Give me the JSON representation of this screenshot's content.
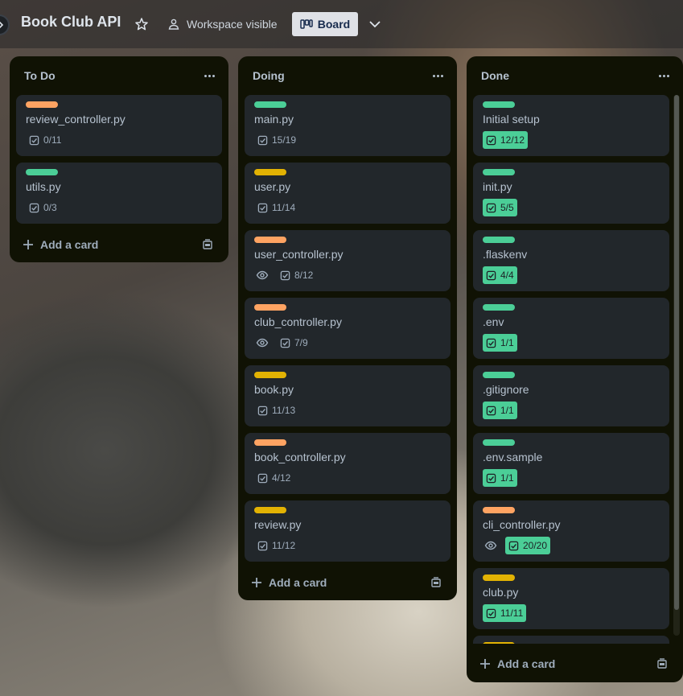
{
  "header": {
    "board_title": "Book Club API",
    "visibility_label": "Workspace visible",
    "view_label": "Board"
  },
  "colors": {
    "green": "#4bce97",
    "orange": "#fea362",
    "yellow": "#e2b203",
    "list_bg": "#101204",
    "card_bg": "#22272b"
  },
  "lists": [
    {
      "title": "To Do",
      "cards": [
        {
          "title": "review_controller.py",
          "label": "orange",
          "checklist": "0/11",
          "watching": false,
          "complete": false
        },
        {
          "title": "utils.py",
          "label": "green",
          "checklist": "0/3",
          "watching": false,
          "complete": false
        }
      ],
      "add_card_label": "Add a card"
    },
    {
      "title": "Doing",
      "cards": [
        {
          "title": "main.py",
          "label": "green",
          "checklist": "15/19",
          "watching": false,
          "complete": false
        },
        {
          "title": "user.py",
          "label": "yellow",
          "checklist": "11/14",
          "watching": false,
          "complete": false
        },
        {
          "title": "user_controller.py",
          "label": "orange",
          "checklist": "8/12",
          "watching": true,
          "complete": false
        },
        {
          "title": "club_controller.py",
          "label": "orange",
          "checklist": "7/9",
          "watching": true,
          "complete": false
        },
        {
          "title": "book.py",
          "label": "yellow",
          "checklist": "11/13",
          "watching": false,
          "complete": false
        },
        {
          "title": "book_controller.py",
          "label": "orange",
          "checklist": "4/12",
          "watching": false,
          "complete": false
        },
        {
          "title": "review.py",
          "label": "yellow",
          "checklist": "11/12",
          "watching": false,
          "complete": false
        }
      ],
      "add_card_label": "Add a card"
    },
    {
      "title": "Done",
      "cards": [
        {
          "title": "Initial setup",
          "label": "green",
          "checklist": "12/12",
          "watching": false,
          "complete": true
        },
        {
          "title": "init.py",
          "label": "green",
          "checklist": "5/5",
          "watching": false,
          "complete": true
        },
        {
          "title": ".flaskenv",
          "label": "green",
          "checklist": "4/4",
          "watching": false,
          "complete": true
        },
        {
          "title": ".env",
          "label": "green",
          "checklist": "1/1",
          "watching": false,
          "complete": true
        },
        {
          "title": ".gitignore",
          "label": "green",
          "checklist": "1/1",
          "watching": false,
          "complete": true
        },
        {
          "title": ".env.sample",
          "label": "green",
          "checklist": "1/1",
          "watching": false,
          "complete": true
        },
        {
          "title": "cli_controller.py",
          "label": "orange",
          "checklist": "20/20",
          "watching": true,
          "complete": true
        },
        {
          "title": "club.py",
          "label": "yellow",
          "checklist": "11/11",
          "watching": false,
          "complete": true
        },
        {
          "title": "",
          "label": "yellow",
          "checklist": "",
          "watching": false,
          "complete": false
        }
      ],
      "add_card_label": "Add a card"
    }
  ]
}
